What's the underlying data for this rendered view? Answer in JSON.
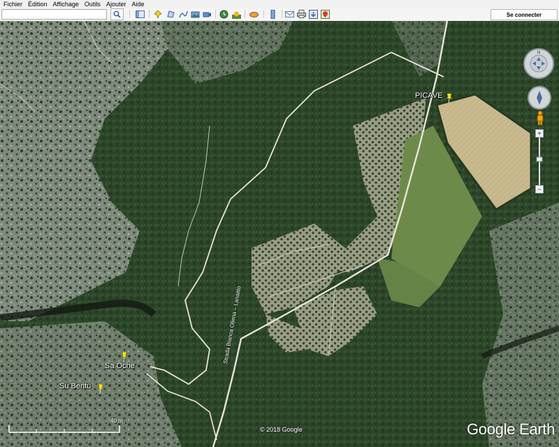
{
  "menu": {
    "items": [
      "Fichier",
      "Édition",
      "Affichage",
      "Outils",
      "Ajouter",
      "Aide"
    ]
  },
  "toolbar": {
    "search_value": "",
    "search_icon": "search-icon",
    "tools": [
      "sidebar-toggle-icon",
      "add-placemark-icon",
      "add-polygon-icon",
      "add-path-icon",
      "add-image-overlay-icon",
      "record-tour-icon",
      "historical-imagery-icon",
      "sun-icon",
      "planets-icon",
      "ruler-icon",
      "email-icon",
      "print-icon",
      "save-image-icon",
      "view-in-maps-icon"
    ],
    "sign_in_label": "Se connecter"
  },
  "map": {
    "placemarks": [
      {
        "label": "PICAVE",
        "icon": "yellow-pushpin-icon"
      },
      {
        "label": "Sa Oche",
        "icon": "yellow-pushpin-icon"
      },
      {
        "label": "Su Bentu",
        "icon": "yellow-pushpin-icon"
      }
    ],
    "road_label": "Strada Bianca Oliena – Lanaitto",
    "scale_label": "40 m",
    "copyright": "© 2018 Google",
    "logo": "Google Earth",
    "colors": {
      "forest": "#2f4a2b",
      "rock": "#9aa398",
      "field": "#c9b98e",
      "road": "#e8e4da",
      "pin": "#f5e31a"
    }
  },
  "nav": {
    "compass_icon": "compass-icon",
    "look_icon": "look-joystick-icon",
    "pegman_icon": "street-view-pegman-icon",
    "zoom_in_icon": "zoom-in-icon",
    "zoom_out_icon": "zoom-out-icon"
  }
}
